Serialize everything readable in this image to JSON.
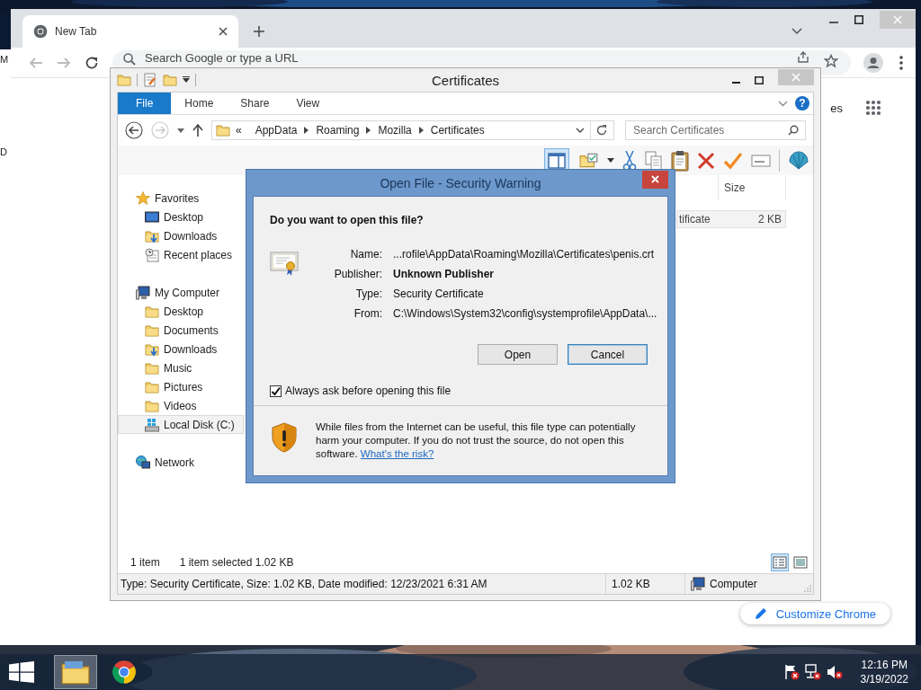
{
  "background_window": {
    "texts": [
      "M",
      "D"
    ]
  },
  "browser": {
    "tabs": [
      {
        "title": "New Tab",
        "selected": true
      }
    ],
    "omnibox": {
      "placeholder": "Search Google or type a URL"
    },
    "header_link": "es",
    "customize_button": "Customize Chrome"
  },
  "explorer": {
    "title": "Certificates",
    "ribbon_tabs": [
      {
        "label": "File",
        "selected": true
      },
      {
        "label": "Home",
        "selected": false
      },
      {
        "label": "Share",
        "selected": false
      },
      {
        "label": "View",
        "selected": false
      }
    ],
    "help": "?",
    "breadcrumb_overflow": "«",
    "breadcrumb": [
      "AppData",
      "Roaming",
      "Mozilla",
      "Certificates"
    ],
    "search": {
      "placeholder": "Search Certificates"
    },
    "preview_pane": {
      "on": true
    },
    "nav": [
      {
        "label": "Favorites",
        "kind": "favorites",
        "selected": false,
        "children": [
          {
            "label": "Desktop",
            "kind": "screen",
            "selected": false
          },
          {
            "label": "Downloads",
            "kind": "downloads",
            "selected": false
          },
          {
            "label": "Recent places",
            "kind": "recent",
            "selected": false
          }
        ]
      },
      {
        "label": "My Computer",
        "kind": "computer",
        "selected": false,
        "children": [
          {
            "label": "Desktop",
            "kind": "folder",
            "selected": false
          },
          {
            "label": "Documents",
            "kind": "folder",
            "selected": false
          },
          {
            "label": "Downloads",
            "kind": "downloads",
            "selected": false
          },
          {
            "label": "Music",
            "kind": "folder",
            "selected": false
          },
          {
            "label": "Pictures",
            "kind": "folder",
            "selected": false
          },
          {
            "label": "Videos",
            "kind": "folder",
            "selected": false
          },
          {
            "label": "Local Disk (C:)",
            "kind": "drive",
            "selected": true
          }
        ]
      },
      {
        "label": "Network",
        "kind": "network",
        "selected": false
      }
    ],
    "columns": [
      {
        "label": "Size"
      }
    ],
    "rows": [
      {
        "name": "tificate",
        "size": "2 KB"
      }
    ],
    "status": {
      "count": "1 item",
      "selection": "1 item selected  1.02 KB"
    },
    "views": [
      {
        "kind": "details",
        "selected": true
      },
      {
        "kind": "tiles",
        "selected": false
      }
    ],
    "details_bar": {
      "info": "Type: Security Certificate, Size: 1.02 KB, Date modified: 12/23/2021 6:31 AM",
      "size": "1.02 KB",
      "location": "Computer"
    }
  },
  "dialog": {
    "title": "Open File - Security Warning",
    "question": "Do you want to open this file?",
    "fields": [
      {
        "label": "Name:",
        "value": "...rofile\\AppData\\Roaming\\Mozilla\\Certificates\\penis.crt",
        "emphasis": false
      },
      {
        "label": "Publisher:",
        "value": "Unknown Publisher",
        "emphasis": true
      },
      {
        "label": "Type:",
        "value": "Security Certificate",
        "emphasis": false
      },
      {
        "label": "From:",
        "value": "C:\\Windows\\System32\\config\\systemprofile\\AppData\\...",
        "emphasis": false
      }
    ],
    "buttons": [
      {
        "label": "Open",
        "default": false
      },
      {
        "label": "Cancel",
        "default": true
      }
    ],
    "always_ask": {
      "label": "Always ask before opening this file",
      "checked": true
    },
    "warning": "While files from the Internet can be useful, this file type can potentially harm your computer. If you do not trust the source, do not open this software. ",
    "risk_link": "What's the risk?"
  },
  "taskbar": {
    "apps": [
      {
        "kind": "explorer",
        "selected": true
      },
      {
        "kind": "chrome",
        "selected": false
      }
    ],
    "time": "12:16 PM",
    "date": "3/19/2022"
  }
}
